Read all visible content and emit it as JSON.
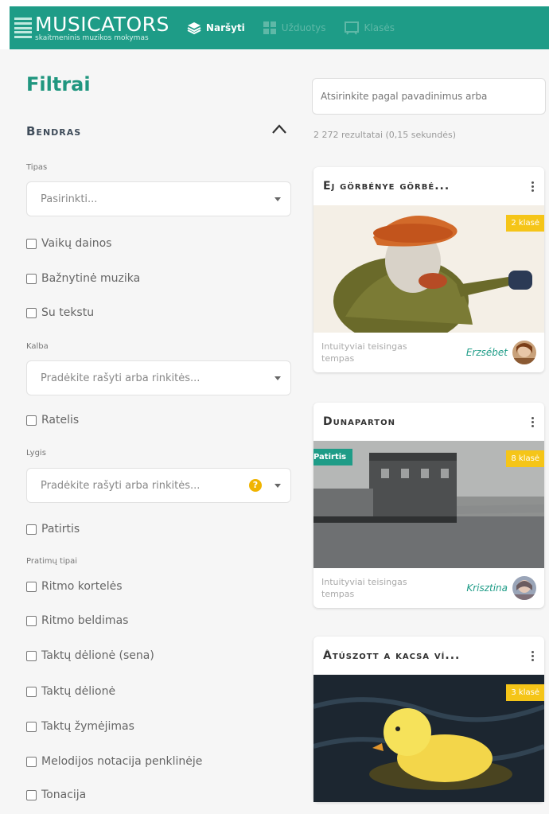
{
  "header": {
    "brand_title": "MUSICATORS",
    "brand_subtitle": "skaitmeninis muzikos mokymas",
    "nav": [
      {
        "label": "Naršyti",
        "icon": "layers-icon",
        "active": true
      },
      {
        "label": "Užduotys",
        "icon": "grid-icon",
        "active": false
      },
      {
        "label": "Klasės",
        "icon": "board-icon",
        "active": false
      }
    ],
    "accent_color": "#1e9c87"
  },
  "filters": {
    "title": "Filtrai",
    "section_title": "Bendras",
    "type_label": "Tipas",
    "type_placeholder": "Pasirinkti...",
    "type_checks": [
      "Vaikų dainos",
      "Bažnytinė muzika",
      "Su tekstu"
    ],
    "key_label": "Kalba",
    "key_placeholder": "Pradėkite rašyti arba rinkitės...",
    "key_checks": [
      "Ratelis"
    ],
    "level_label": "Lygis",
    "level_placeholder": "Pradėkite rašyti arba rinkitės...",
    "level_help": "?",
    "level_checks": [
      "Patirtis"
    ],
    "exercise_label": "Pratimų tipai",
    "exercise_checks": [
      "Ritmo kortelės",
      "Ritmo beldimas",
      "Taktų dėlionė (sena)",
      "Taktų dėlionė",
      "Taktų žymėjimas",
      "Melodijos notacija penklinėje",
      "Tonacija"
    ]
  },
  "results": {
    "search_placeholder": "Atsirinkite pagal pavadinimus arba",
    "count_text": "2 272 rezultatai (0,15 sekundės)",
    "cards": [
      {
        "title": "Ej görbénye görbé...",
        "badge": "2 klasė",
        "ribbon": "",
        "note": "Intuityviai teisingas tempas",
        "author": "Erzsébet"
      },
      {
        "title": "Dunaparton",
        "badge": "8 klasė",
        "ribbon": "Patirtis",
        "note": "Intuityviai teisingas tempas",
        "author": "Krisztina"
      },
      {
        "title": "Átúszott a kacsa ví...",
        "badge": "3 klasė",
        "ribbon": "",
        "note": "",
        "author": ""
      }
    ]
  }
}
